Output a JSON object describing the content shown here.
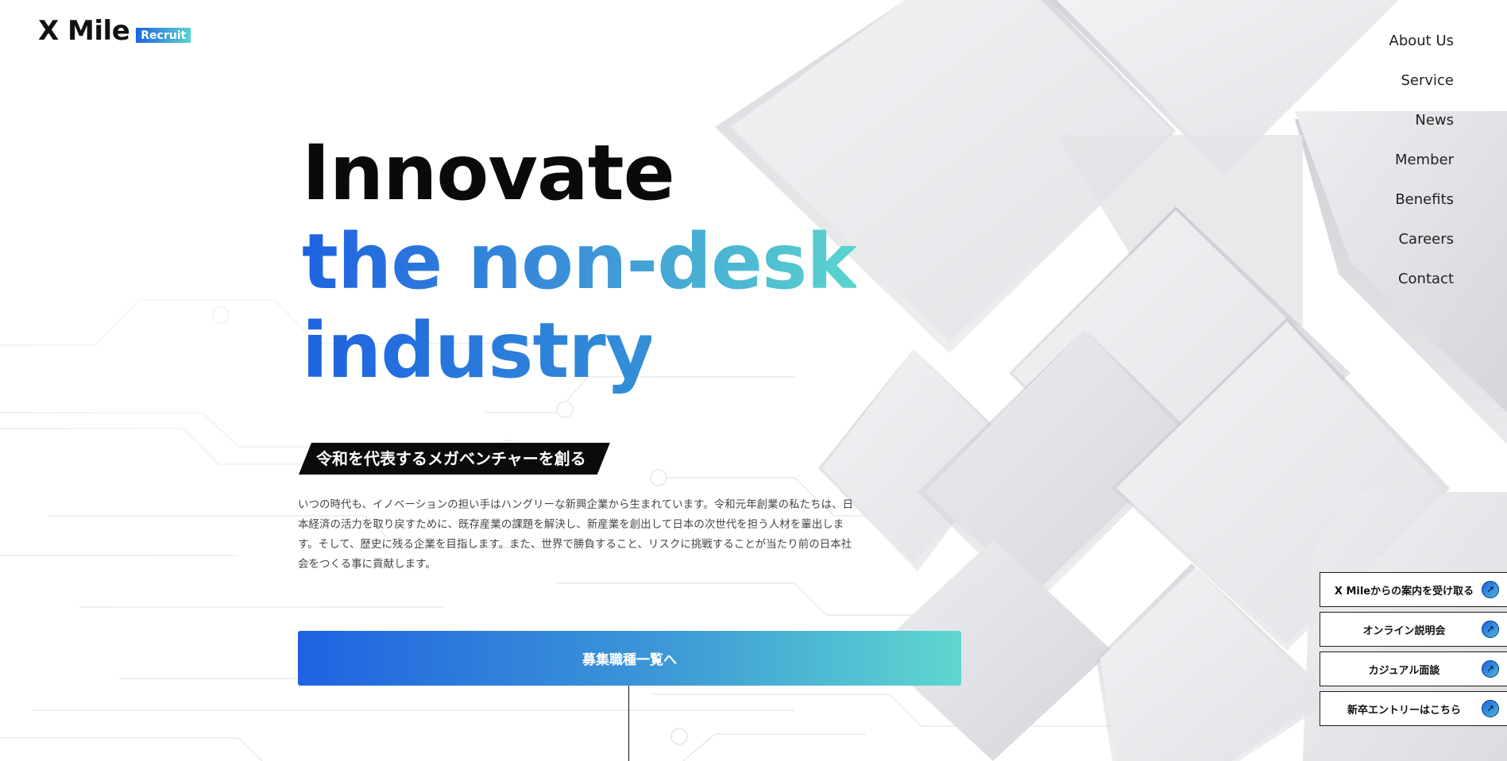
{
  "brand": {
    "name": "X Mile",
    "badge": "Recruit",
    "accent_start": "#1f62e1",
    "accent_end": "#5ed7d0"
  },
  "nav": {
    "items": [
      {
        "label": "About Us"
      },
      {
        "label": "Service"
      },
      {
        "label": "News"
      },
      {
        "label": "Member"
      },
      {
        "label": "Benefits"
      },
      {
        "label": "Careers"
      },
      {
        "label": "Contact"
      }
    ]
  },
  "hero": {
    "line1": "Innovate",
    "line2": "the non-desk",
    "line3": "industry"
  },
  "tagline": "令和を代表するメガベンチャーを創る",
  "lead": "いつの時代も、イノベーションの担い手はハングリーな新興企業から生まれています。令和元年創業の私たちは、日本経済の活力を取り戻すために、既存産業の課題を解決し、新産業を創出して日本の次世代を担う人材を輩出します。そして、歴史に残る企業を目指します。また、世界で勝負すること、リスクに挑戦することが当たり前の日本社会をつくる事に貢献します。",
  "cta": {
    "label": "募集職種一覧へ"
  },
  "side_buttons": [
    {
      "label": "X Mileからの案内を受け取る",
      "icon": "arrow-up-right-icon"
    },
    {
      "label": "オンライン説明会",
      "icon": "arrow-up-right-icon"
    },
    {
      "label": "カジュアル面談",
      "icon": "arrow-up-right-icon"
    },
    {
      "label": "新卒エントリーはこちら",
      "icon": "arrow-up-right-icon"
    }
  ]
}
